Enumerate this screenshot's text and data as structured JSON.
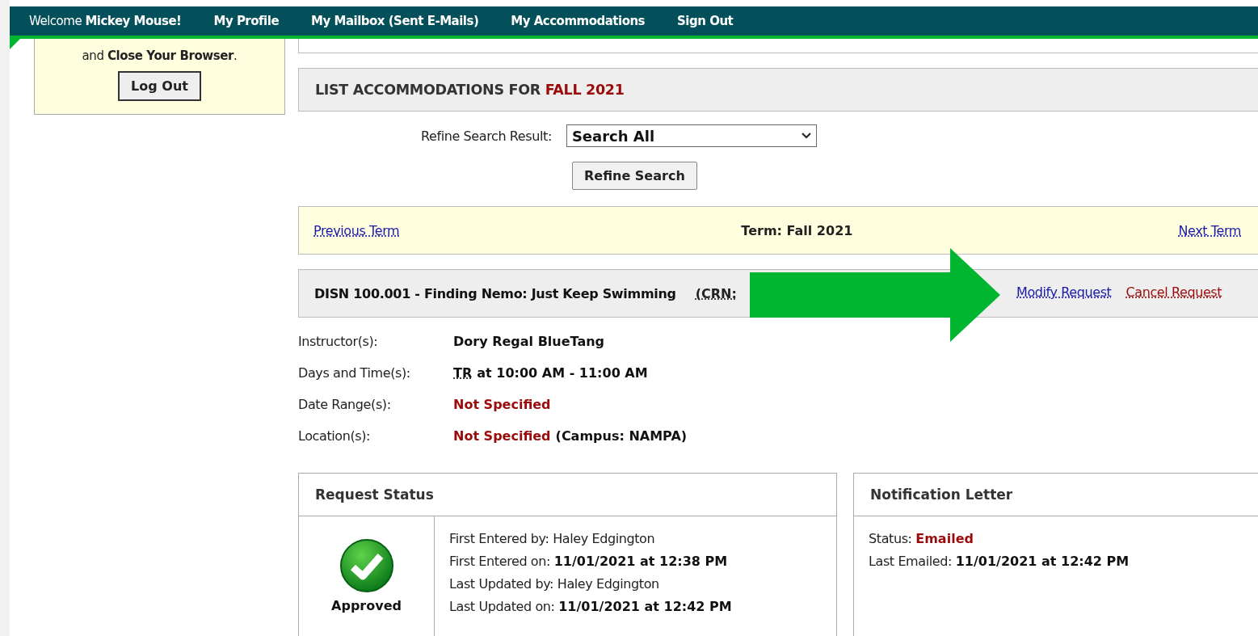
{
  "nav": {
    "welcome": "Welcome",
    "user": "Mickey Mouse!",
    "links": [
      {
        "label": "My Profile"
      },
      {
        "label": "My Mailbox (Sent E-Mails)"
      },
      {
        "label": "My Accommodations"
      },
      {
        "label": "Sign Out"
      }
    ]
  },
  "sidebar": {
    "note": "and **Close Your Browser**.",
    "button": "Log Out"
  },
  "list_header": {
    "title": "LIST ACCOMMODATIONS FOR",
    "term": "FALL 2021"
  },
  "refine": {
    "label": "Refine Search Result:",
    "value": "Search All",
    "button": "Refine Search"
  },
  "term_bar": {
    "previous": "Previous Term",
    "current": "Term: Fall 2021",
    "next": "Next Term"
  },
  "course": {
    "title": "DISN 100.001 - Finding Nemo: Just Keep Swimming",
    "crn": "(CRN:",
    "actions": [
      {
        "label": "Modify Request",
        "kind": "link"
      },
      {
        "label": "Cancel Request",
        "kind": "danger"
      }
    ]
  },
  "details": [
    {
      "label": "Instructor(s):",
      "parts": [
        {
          "text": "Dory Regal BlueTang",
          "kind": "plain"
        }
      ]
    },
    {
      "label": "Days and Time(s):",
      "parts": [
        {
          "text": "TR",
          "kind": "abbr"
        },
        {
          "text": "at 10:00 AM - 11:00 AM",
          "kind": "plain"
        }
      ]
    },
    {
      "label": "Date Range(s):",
      "parts": [
        {
          "text": "Not Specified",
          "kind": "alert"
        }
      ]
    },
    {
      "label": "Location(s):",
      "parts": [
        {
          "text": "Not Specified",
          "kind": "alert"
        },
        {
          "text": "(Campus: NAMPA)",
          "kind": "plain"
        }
      ]
    }
  ],
  "request_status": {
    "title": "Request Status",
    "status": "Approved",
    "lines": [
      {
        "label": "First Entered by:",
        "value": "Haley Edgington",
        "kind": "plain"
      },
      {
        "label": "First Entered on:",
        "value": "11/01/2021 at 12:38 PM",
        "kind": "strong"
      },
      {
        "label": "Last Updated by:",
        "value": "Haley Edgington",
        "kind": "plain"
      },
      {
        "label": "Last Updated on:",
        "value": "11/01/2021 at 12:42 PM",
        "kind": "strong"
      }
    ]
  },
  "notification": {
    "title": "Notification Letter",
    "lines": [
      {
        "label": "Status:",
        "value": "Emailed",
        "kind": "alert"
      },
      {
        "label": "Last Emailed:",
        "value": "11/01/2021 at 12:42 PM",
        "kind": "strong"
      }
    ]
  }
}
